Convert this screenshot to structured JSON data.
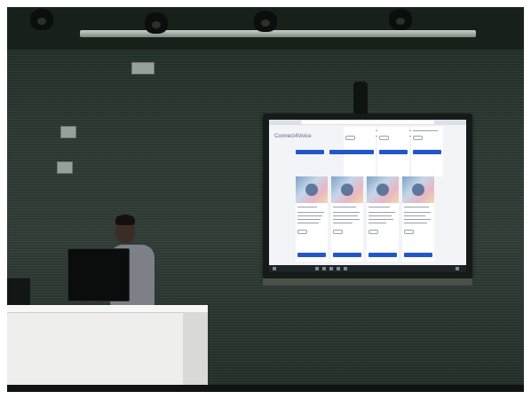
{
  "screen": {
    "logo_text": "Connect4Voice"
  }
}
